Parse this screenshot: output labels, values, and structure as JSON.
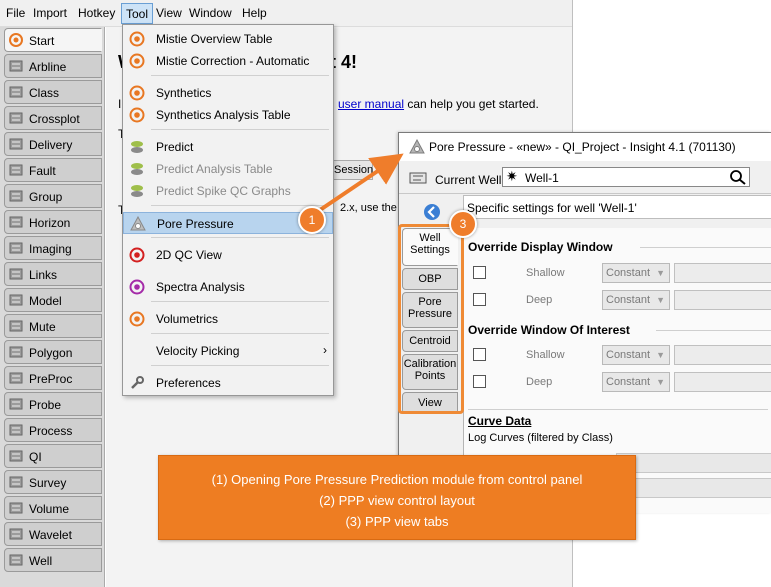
{
  "menubar": {
    "items": [
      "File",
      "Import",
      "Hotkey",
      "Tool",
      "View",
      "Window",
      "Help"
    ]
  },
  "left_panel": {
    "tabs": [
      "Start",
      "Arbline",
      "Class",
      "Crossplot",
      "Delivery",
      "Fault",
      "Group",
      "Horizon",
      "Imaging",
      "Links",
      "Model",
      "Mute",
      "Polygon",
      "PreProc",
      "Probe",
      "Process",
      "QI",
      "Survey",
      "Volume",
      "Wavelet",
      "Well"
    ]
  },
  "background": {
    "title_fragment": "t 4!",
    "line_prefix": "I",
    "manual_link": "user manual",
    "line_suffix": " can help you get started.",
    "frag_t1": "T",
    "session_fragment": "Session",
    "frag_t2": "T",
    "version_fragment": "2.x, use the I"
  },
  "tool_menu": {
    "items": [
      {
        "label": "Mistie Overview Table",
        "icon": "orange-circle-icon",
        "disabled": false
      },
      {
        "label": "Mistie Correction - Automatic",
        "icon": "orange-circle-icon",
        "disabled": false
      },
      {
        "label": "Synthetics",
        "icon": "orange-circle-icon",
        "disabled": false
      },
      {
        "label": "Synthetics Analysis Table",
        "icon": "orange-circle-icon",
        "disabled": false
      },
      {
        "label": "Predict",
        "icon": "predict-icon",
        "disabled": false
      },
      {
        "label": "Predict Analysis Table",
        "icon": "predict-icon",
        "disabled": true
      },
      {
        "label": "Predict Spike QC Graphs",
        "icon": "predict-icon",
        "disabled": true
      },
      {
        "label": "Pore Pressure",
        "icon": "pore-pressure-icon",
        "disabled": false
      },
      {
        "label": "2D QC View",
        "icon": "red-circle-icon",
        "disabled": false
      },
      {
        "label": "Spectra Analysis",
        "icon": "purple-circle-icon",
        "disabled": false
      },
      {
        "label": "Volumetrics",
        "icon": "orange-circle-icon",
        "disabled": false
      },
      {
        "label": "Velocity Picking",
        "icon": "",
        "disabled": false
      },
      {
        "label": "Preferences",
        "icon": "wrench-icon",
        "disabled": false
      }
    ]
  },
  "dialog": {
    "title": "Pore Pressure - «new» - QI_Project - Insight 4.1 (701130)",
    "current_well_label": "Current Well",
    "current_well_value": "Well-1",
    "specific_settings": "Specific settings for well 'Well-1'",
    "vtabs": [
      {
        "label": "Well Settings"
      },
      {
        "label": "OBP"
      },
      {
        "label": "Pore Pressure"
      },
      {
        "label": "Centroid"
      },
      {
        "label": "Calibration Points"
      },
      {
        "label": "View"
      }
    ],
    "override_display": "Override Display Window",
    "override_interest": "Override Window Of Interest",
    "shallow": "Shallow",
    "deep": "Deep",
    "constant": "Constant",
    "curve_data": "Curve Data",
    "log_curves": "Log Curves (filtered by Class)"
  },
  "callouts": [
    "1",
    "3"
  ],
  "note": {
    "line1": "(1) Opening Pore Pressure Prediction module from control panel",
    "line2": "(2) PPP view control layout",
    "line3": "(3) PPP view tabs"
  },
  "colors": {
    "accent_orange": "#ee7d22",
    "menu_selected": "#b8d4ee"
  }
}
